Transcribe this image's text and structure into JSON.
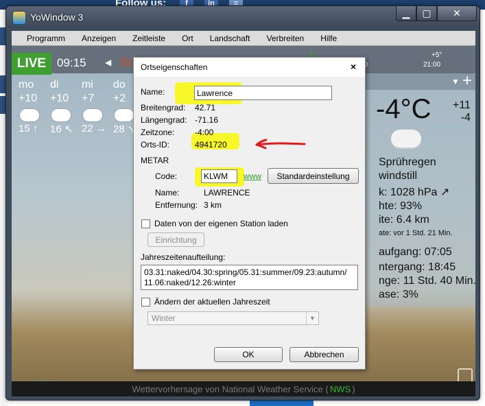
{
  "background": {
    "follow_text": "Follow us:"
  },
  "window": {
    "title": "YoWindow 3",
    "minimize_glyph": "▁",
    "maximize_glyph": "▢",
    "close_glyph": "✕"
  },
  "menu": {
    "items": [
      "Programm",
      "Anzeigen",
      "Zeitleiste",
      "Ort",
      "Landschaft",
      "Verbreiten",
      "Hilfe"
    ]
  },
  "weather": {
    "live_label": "LIVE",
    "time": "09:15",
    "day_short": "So",
    "timeline_labels": [
      "00",
      "+5°",
      "21:00"
    ],
    "forecast": [
      {
        "day": "mo",
        "temp": "+10",
        "wind": "15 ↑"
      },
      {
        "day": "di",
        "temp": "+10",
        "wind": "16 ↖"
      },
      {
        "day": "mi",
        "temp": "+7",
        "wind": "22 →"
      },
      {
        "day": "do",
        "temp": "+2",
        "wind": "28 ↘"
      }
    ],
    "current_temp": "-4°C",
    "high": "+11",
    "low": "-4",
    "details": [
      "Sprühregen",
      "windstill",
      "k: 1028 hPa ↗",
      "hte: 93%",
      "ite: 6.4 km",
      "ate: vor 1 Std. 21 Min.",
      "aufgang: 07:05",
      "ntergang: 18:45",
      "nge: 11 Std. 40 Min.",
      "ase: 3%"
    ],
    "brand": "YoWindow",
    "footer_prefix": "Wettervorhersage von National Weather Service (",
    "footer_nws": "NWS",
    "footer_suffix": ")"
  },
  "dialog": {
    "title": "Ortseigenschaften",
    "close_glyph": "×",
    "name_label": "Name:",
    "name_value": "Lawrence",
    "lat_label": "Breitengrad:",
    "lat_value": "42.71",
    "lon_label": "Längengrad:",
    "lon_value": "-71.16",
    "tz_label": "Zeitzone:",
    "tz_value": "-4:00",
    "id_label": "Orts-ID:",
    "id_value": "4941720",
    "metar_heading": "METAR",
    "code_label": "Code:",
    "code_value": "KLWM",
    "www_link": "www",
    "default_button": "Standardeinstellung",
    "metar_name_label": "Name:",
    "metar_name_value": "LAWRENCE",
    "distance_label": "Entfernung:",
    "distance_value": "3 km",
    "own_station_label": "Daten von der eigenen Station laden",
    "setup_button": "Einrichtung",
    "seasons_label": "Jahreszeitenaufteilung:",
    "seasons_line1": "03.31:naked/04.30:spring/05.31:summer/09.23:autumn/",
    "seasons_line2": "11.06:naked/12.26:winter",
    "change_season_label": "Ändern der aktuellen Jahreszeit",
    "season_select": "Winter",
    "ok_button": "OK",
    "cancel_button": "Abbrechen"
  }
}
